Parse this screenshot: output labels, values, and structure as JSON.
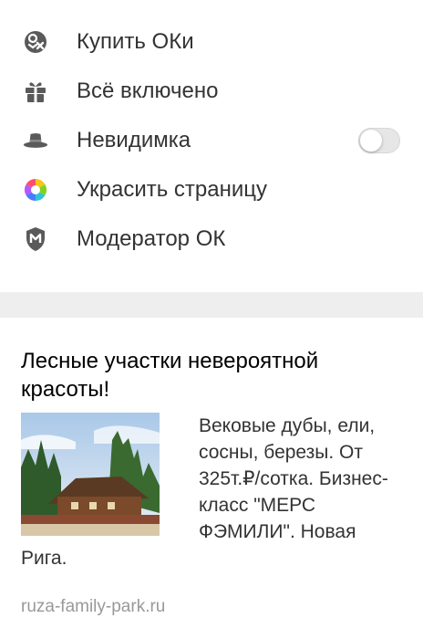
{
  "menu": {
    "items": [
      {
        "label": "Купить ОКи",
        "icon": "ok-coins-icon"
      },
      {
        "label": "Всё включено",
        "icon": "gift-icon"
      },
      {
        "label": "Невидимка",
        "icon": "hat-icon",
        "toggle_on": false
      },
      {
        "label": "Украсить страницу",
        "icon": "color-wheel-icon"
      },
      {
        "label": "Модератор ОК",
        "icon": "moderator-shield-icon"
      }
    ]
  },
  "ad": {
    "title": "Лесные участки невероятной красоты!",
    "text": "Вековые дубы, ели, сосны, березы. От 325т.₽/сотка. Бизнес-класс \"МЕРС ФЭМИЛИ\". Новая Рига.",
    "domain": "ruza-family-park.ru"
  },
  "colors": {
    "icon_gray": "#555555",
    "text": "#333333",
    "divider": "#eeeeee",
    "domain": "#999999"
  }
}
